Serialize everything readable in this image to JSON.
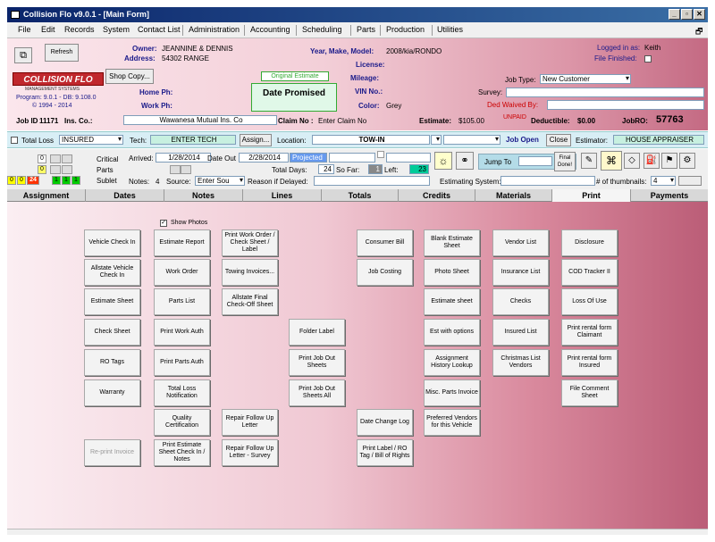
{
  "window": {
    "title": "Collision Flo v9.0.1 - [Main Form]"
  },
  "menu": [
    "File",
    "Edit",
    "Records",
    "System",
    "Contact List",
    "Administration",
    "Accounting",
    "Scheduling",
    "Parts",
    "Production",
    "Utilities"
  ],
  "header": {
    "refresh_label": "Refresh",
    "logo_text": "COLLISION FLO",
    "logo_sub": "MANAGEMENT SYSTEMS",
    "program_line1": "Program: 9.0.1 - DB: 9.108.0",
    "program_line2": "© 1994 - 2014",
    "shop_copy_label": "Shop Copy...",
    "owner_label": "Owner:",
    "owner_value": "JEANNINE & DENNIS",
    "address_label": "Address:",
    "address_value": "54302 RANGE",
    "home_ph_label": "Home Ph:",
    "work_ph_label": "Work Ph:",
    "original_estimate_label": "Original Estimate",
    "date_promised_label": "Date Promised",
    "ymm_label": "Year, Make, Model:",
    "ymm_value": "2008/kia/RONDO",
    "license_label": "License:",
    "mileage_label": "Mileage:",
    "vin_label": "VIN No.:",
    "color_label": "Color:",
    "color_value": "Grey",
    "logged_in_label": "Logged in as:",
    "logged_in_value": "Keith",
    "file_finished_label": "File Finished:",
    "job_type_label": "Job Type:",
    "job_type_value": "New Customer",
    "survey_label": "Survey:",
    "ded_waived_label": "Ded Waived By:",
    "job_id_label": "Job ID",
    "job_id_value": "11171",
    "ins_co_label": "Ins. Co.:",
    "ins_co_value": "Wawanesa Mutual Ins. Co",
    "claim_label": "Claim No :",
    "claim_value": "Enter Claim No",
    "estimate_label": "Estimate:",
    "estimate_value": "$105.00",
    "unpaid_label": "UNPAID",
    "deductible_label": "Deductible:",
    "deductible_value": "$0.00",
    "jobro_label": "JobRO:",
    "jobro_value": "57763"
  },
  "row2": {
    "total_loss_label": "Total Loss",
    "insured_value": "INSURED",
    "tech_label": "Tech:",
    "tech_value": "ENTER TECH",
    "assign_label": "Assign...",
    "location_label": "Location:",
    "location_value": "TOW-IN",
    "job_open_label": "Job Open",
    "close_label": "Close",
    "estimator_label": "Estimator:",
    "estimator_value": "HOUSE APPRAISER"
  },
  "row3": {
    "counts": [
      "0",
      "0",
      "0",
      "0",
      "24",
      "1",
      "1",
      "1"
    ],
    "critical_label": "Critical",
    "parts_label": "Parts",
    "sublet_label": "Sublet",
    "arrived_label": "Arrived:",
    "arrived_value": "1/28/2014",
    "date_out_label": "Date Out",
    "date_out_value": "2/28/2014",
    "projected_label": "Projected",
    "total_days_label": "Total Days:",
    "total_days_value": "24",
    "so_far_label": "So Far:",
    "so_far_value": "1",
    "left_label": "Left:",
    "left_value": "23",
    "notes_label": "Notes:",
    "notes_value": "4",
    "source_label": "Source:",
    "source_value": "Enter Sou",
    "reason_label": "Reason if Delayed:",
    "jump_to_label": "Jump To",
    "final_done_label": "Final Done!",
    "estimating_system_label": "Estimating System:",
    "thumbnails_label": "# of thumbnails:",
    "thumbnails_value": "4"
  },
  "tabs": [
    "Assignment",
    "Dates",
    "Notes",
    "Lines",
    "Totals",
    "Credits",
    "Materials",
    "Print",
    "Payments"
  ],
  "print": {
    "show_photos_label": "Show Photos",
    "col1": [
      "Vehicle Check In",
      "Allstate Vehicle Check In",
      "Estimate Sheet",
      "Check Sheet",
      "RO Tags",
      "Warranty",
      "Re-print Invoice"
    ],
    "col2": [
      "Estimate Report",
      "Work Order",
      "Parts List",
      "Print Work Auth",
      "Print Parts Auth",
      "Total Loss Notification",
      "Quality Certification",
      "Print Estimate Sheet Check In / Notes"
    ],
    "col3": [
      "Print Work Order / Check Sheet / Label",
      "Towing Invoices...",
      "Allstate Final Check-Off Sheet",
      "Repair Follow Up Letter",
      "Repair Follow Up Letter - Survey"
    ],
    "col4": [
      "Folder Label",
      "Print Job Out Sheets",
      "Print Job Out Sheets All"
    ],
    "col5": [
      "Consumer Bill",
      "Job Costing",
      "Date Change Log",
      "Print Label / RO Tag / Bill of Rights"
    ],
    "col6": [
      "Blank Estimate Sheet",
      "Photo Sheet",
      "Estimate sheet",
      "Est with options",
      "Assignment History Lookup",
      "Misc. Parts Invoice",
      "Preferred Vendors for this Vehicle"
    ],
    "col7": [
      "Vendor List",
      "Insurance List",
      "Checks",
      "Insured List",
      "Christmas List Vendors"
    ],
    "col8": [
      "Disclosure",
      "COD Tracker II",
      "Loss Of Use",
      "Print rental form Claimant",
      "Print rental form Insured",
      "File Comment Sheet"
    ]
  },
  "colors": {
    "titlebar": "#0a246a",
    "accent_red": "#cc0000",
    "green_status": "#00cc00",
    "yellow_status": "#ffff00"
  }
}
